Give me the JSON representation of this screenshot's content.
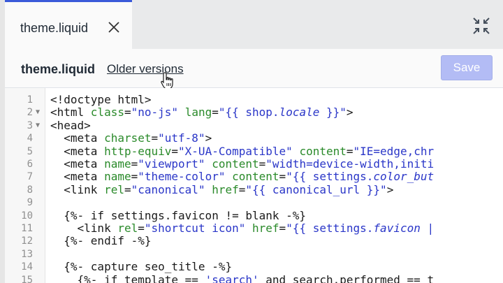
{
  "tab": {
    "label": "theme.liquid"
  },
  "header": {
    "file_title": "theme.liquid",
    "older_versions_label": "Older versions",
    "save_label": "Save"
  },
  "icons": {
    "tab_close": "close-icon",
    "collapse": "collapse-icon",
    "cursor": "pointer-hand-icon"
  },
  "colors": {
    "tab_accent": "#3a5ad9",
    "save_disabled": "#b3bcf5",
    "attr": "#2a8a2a",
    "string": "#2a36c8"
  },
  "editor": {
    "lines": [
      {
        "n": "1",
        "fold": false,
        "tokens": [
          [
            "tag",
            "<!doctype html>"
          ]
        ]
      },
      {
        "n": "2",
        "fold": true,
        "tokens": [
          [
            "tag",
            "<html "
          ],
          [
            "attr",
            "class"
          ],
          [
            "tag",
            "="
          ],
          [
            "str",
            "\"no-js\""
          ],
          [
            "tag",
            " "
          ],
          [
            "attr",
            "lang"
          ],
          [
            "tag",
            "="
          ],
          [
            "str",
            "\"{{ shop."
          ],
          [
            "it",
            "locale"
          ],
          [
            "str",
            " }}\""
          ],
          [
            "tag",
            ">"
          ]
        ]
      },
      {
        "n": "3",
        "fold": true,
        "tokens": [
          [
            "tag",
            "<head>"
          ]
        ]
      },
      {
        "n": "4",
        "fold": false,
        "tokens": [
          [
            "tag",
            "  <meta "
          ],
          [
            "attr",
            "charset"
          ],
          [
            "tag",
            "="
          ],
          [
            "str",
            "\"utf-8\""
          ],
          [
            "tag",
            ">"
          ]
        ]
      },
      {
        "n": "5",
        "fold": false,
        "tokens": [
          [
            "tag",
            "  <meta "
          ],
          [
            "attr",
            "http-equiv"
          ],
          [
            "tag",
            "="
          ],
          [
            "str",
            "\"X-UA-Compatible\""
          ],
          [
            "tag",
            " "
          ],
          [
            "attr",
            "content"
          ],
          [
            "tag",
            "="
          ],
          [
            "str",
            "\"IE=edge,chr"
          ]
        ]
      },
      {
        "n": "6",
        "fold": false,
        "tokens": [
          [
            "tag",
            "  <meta "
          ],
          [
            "attr",
            "name"
          ],
          [
            "tag",
            "="
          ],
          [
            "str",
            "\"viewport\""
          ],
          [
            "tag",
            " "
          ],
          [
            "attr",
            "content"
          ],
          [
            "tag",
            "="
          ],
          [
            "str",
            "\"width=device-width,initi"
          ]
        ]
      },
      {
        "n": "7",
        "fold": false,
        "tokens": [
          [
            "tag",
            "  <meta "
          ],
          [
            "attr",
            "name"
          ],
          [
            "tag",
            "="
          ],
          [
            "str",
            "\"theme-color\""
          ],
          [
            "tag",
            " "
          ],
          [
            "attr",
            "content"
          ],
          [
            "tag",
            "="
          ],
          [
            "str",
            "\"{{ settings."
          ],
          [
            "it",
            "color_but"
          ]
        ]
      },
      {
        "n": "8",
        "fold": false,
        "tokens": [
          [
            "tag",
            "  <link "
          ],
          [
            "attr",
            "rel"
          ],
          [
            "tag",
            "="
          ],
          [
            "str",
            "\"canonical\""
          ],
          [
            "tag",
            " "
          ],
          [
            "attr",
            "href"
          ],
          [
            "tag",
            "="
          ],
          [
            "str",
            "\"{{ canonical_url }}\""
          ],
          [
            "tag",
            ">"
          ]
        ]
      },
      {
        "n": "9",
        "fold": false,
        "tokens": []
      },
      {
        "n": "10",
        "fold": false,
        "tokens": [
          [
            "kw",
            "  {%- if settings.favicon != blank -%}"
          ]
        ]
      },
      {
        "n": "11",
        "fold": false,
        "tokens": [
          [
            "tag",
            "    <link "
          ],
          [
            "attr",
            "rel"
          ],
          [
            "tag",
            "="
          ],
          [
            "str",
            "\"shortcut icon\""
          ],
          [
            "tag",
            " "
          ],
          [
            "attr",
            "href"
          ],
          [
            "tag",
            "="
          ],
          [
            "str",
            "\"{{ settings."
          ],
          [
            "it",
            "favicon"
          ],
          [
            "str",
            " |"
          ]
        ]
      },
      {
        "n": "12",
        "fold": false,
        "tokens": [
          [
            "kw",
            "  {%- endif -%}"
          ]
        ]
      },
      {
        "n": "13",
        "fold": false,
        "tokens": []
      },
      {
        "n": "14",
        "fold": false,
        "tokens": [
          [
            "kw",
            "  {%- capture seo_title -%}"
          ]
        ]
      },
      {
        "n": "15",
        "fold": false,
        "tokens": [
          [
            "kw",
            "    {%- if template == "
          ],
          [
            "sq",
            "'search'"
          ],
          [
            "kw",
            " and search.performed == t"
          ]
        ]
      }
    ]
  }
}
